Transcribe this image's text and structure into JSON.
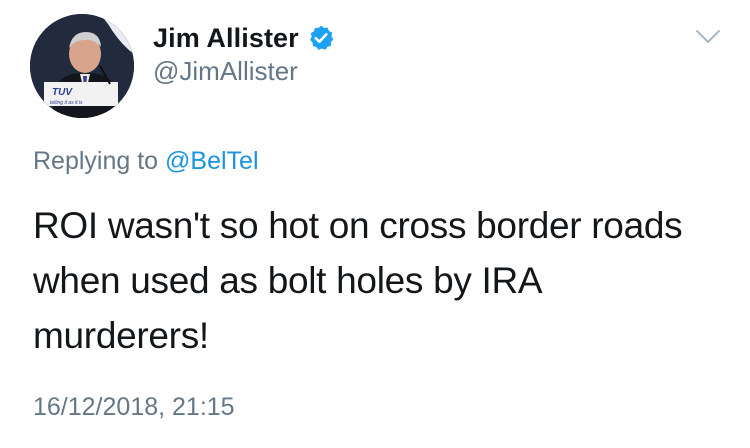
{
  "author": {
    "display_name": "Jim Allister",
    "handle": "@JimAllister",
    "verified": true,
    "avatar_banner_text": "TUV",
    "avatar_banner_subtext": "telling it as it is"
  },
  "reply": {
    "prefix": "Replying to",
    "target": "@BelTel"
  },
  "tweet": {
    "text": "ROI wasn't so hot on cross border roads when used as bolt holes by IRA murderers!",
    "timestamp": "16/12/2018, 21:15"
  },
  "colors": {
    "text": "#14171a",
    "secondary": "#657786",
    "link": "#1b95e0",
    "verified": "#1da1f2"
  },
  "icons": {
    "verified": "verified-badge-icon",
    "menu": "chevron-down-icon"
  }
}
